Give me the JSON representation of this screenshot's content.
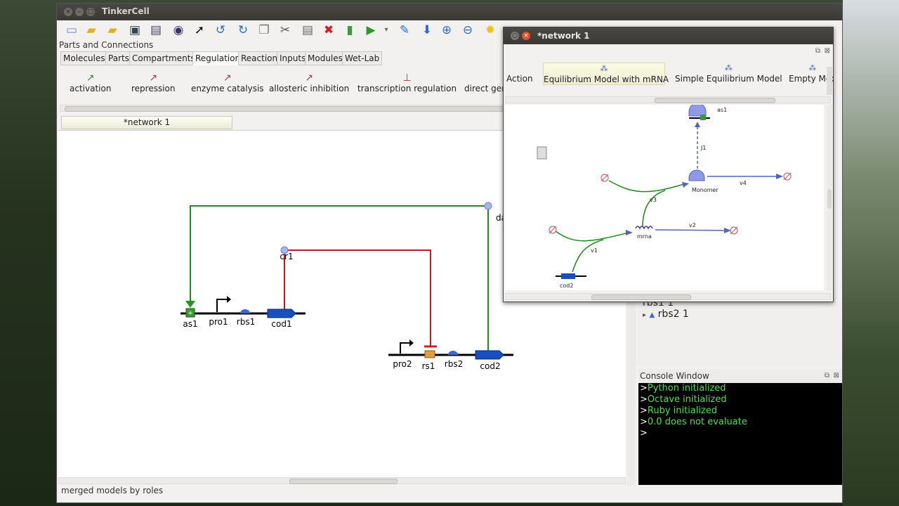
{
  "app": {
    "title": "TinkerCell"
  },
  "toolbar": {
    "icons": [
      "new-icon",
      "open-icon",
      "open-folder-icon",
      "save-icon",
      "print-icon",
      "screenshot-icon",
      "pointer-icon",
      "undo-icon",
      "redo-icon",
      "copy-icon",
      "cut-icon",
      "paste-icon",
      "delete-icon",
      "plot-icon",
      "run-icon",
      "settings-icon",
      "arrow-down-icon",
      "zoom-in-icon",
      "zoom-out-icon",
      "light-icon"
    ]
  },
  "panel": {
    "title": "Parts and Connections"
  },
  "tabs": [
    "Molecules",
    "Parts",
    "Compartments",
    "Regulation",
    "Reaction",
    "Inputs",
    "Modules",
    "Wet-Lab"
  ],
  "active_tab": "Regulation",
  "palette": [
    "activation",
    "repression",
    "enzyme catalysis",
    "allosteric inhibition",
    "transcription regulation",
    "direct gen"
  ],
  "doc_tab": "*network 1",
  "diagram": {
    "parts_top": [
      "as1",
      "pro1",
      "rbs1",
      "cod1"
    ],
    "parts_bottom": [
      "pro2",
      "rs1",
      "rbs2",
      "cod2"
    ],
    "labels": {
      "cr1": "cr1",
      "da": "da"
    }
  },
  "status": "merged models by roles",
  "tree": {
    "row1": "rbs1  1",
    "row2": "rbs2   1"
  },
  "console": {
    "title": "Console Window",
    "lines": [
      "Python initialized",
      "Octave initialized",
      "Ruby initialized",
      "0.0 does not evaluate",
      ""
    ]
  },
  "float_window": {
    "title": "*network 1",
    "palette": [
      "Action",
      "Equilibrium Model with mRNA",
      "Simple Equilibrium Model",
      "Empty Mod"
    ],
    "nodes": {
      "as1": "as1",
      "monomer": "Monomer",
      "mrna": "mrna",
      "cod2": "cod2"
    },
    "reactions": {
      "j1": "J1",
      "v1": "v1",
      "v2": "v2",
      "v3": "v3",
      "v4": "v4"
    }
  }
}
